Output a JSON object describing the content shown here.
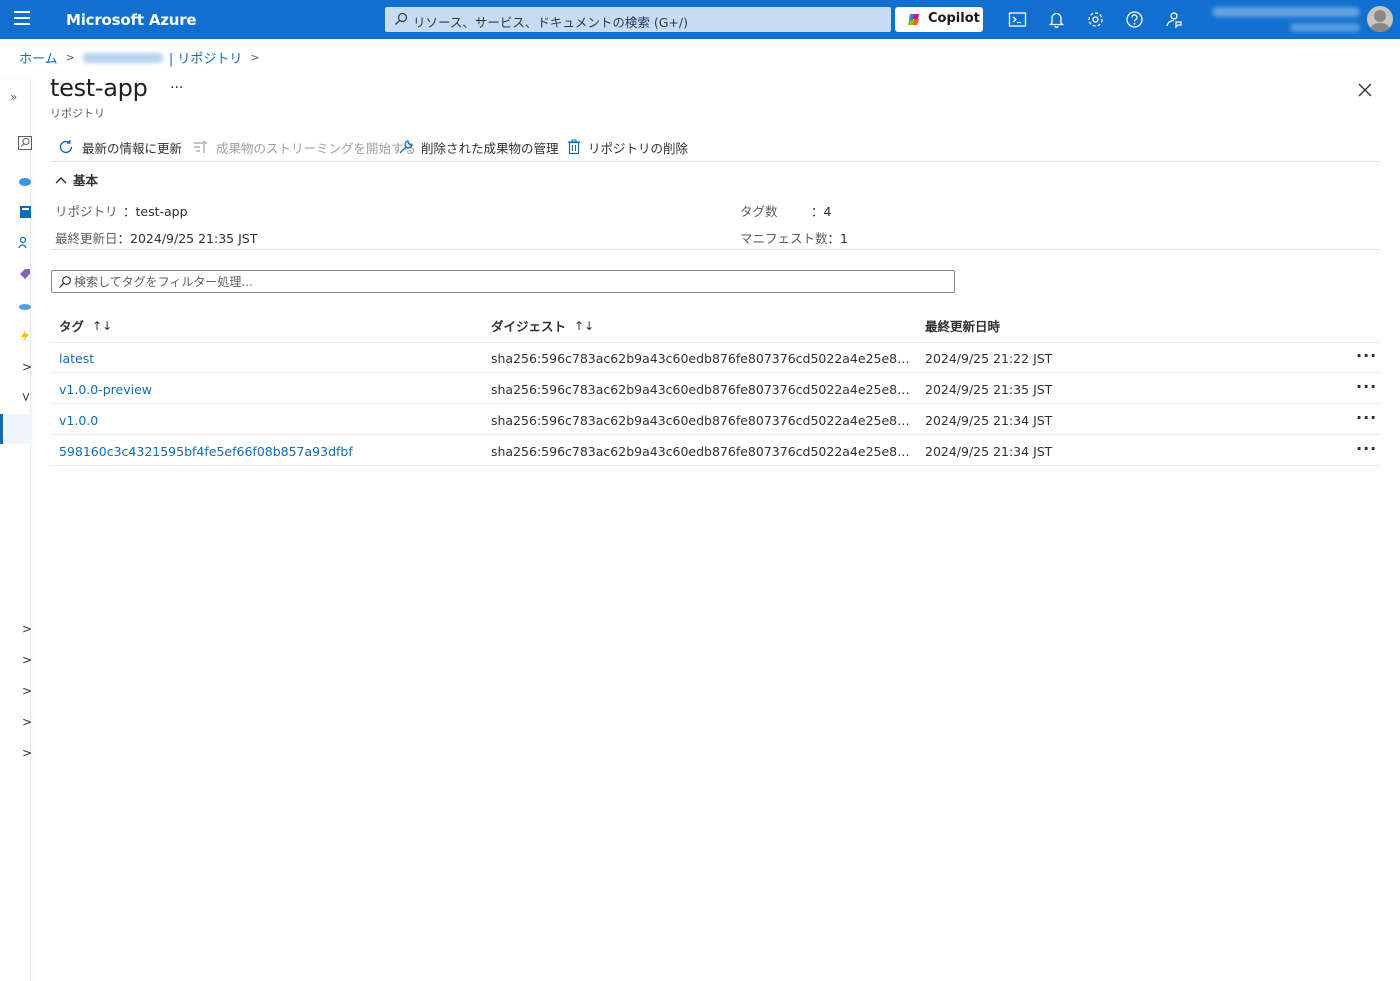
{
  "topbar": {
    "brand": "Microsoft Azure",
    "search_placeholder": "リソース、サービス、ドキュメントの検索 (G+/)",
    "copilot_label": "Copilot"
  },
  "breadcrumb": {
    "home": "ホーム",
    "registry": "| リポジトリ"
  },
  "blade": {
    "title": "test-app",
    "more": "···",
    "subtitle": "リポジトリ"
  },
  "commands": {
    "refresh": "最新の情報に更新",
    "stream": "成果物のストリーミングを開始する",
    "manage_deleted": "削除された成果物の管理",
    "delete_repo": "リポジトリの削除"
  },
  "essentials": {
    "header": "基本",
    "repo_label": "リポジトリ",
    "repo_value": "：test-app",
    "updated_label": "最終更新日",
    "updated_value": "：2024/9/25 21:35 JST",
    "tags_label": "タグ数",
    "tags_value": "：4",
    "manifests_label": "マニフェスト数",
    "manifests_value": "：1"
  },
  "filter": {
    "placeholder": "検索してタグをフィルター処理..."
  },
  "table": {
    "col_tag": "タグ",
    "col_digest": "ダイジェスト",
    "col_updated": "最終更新日時",
    "sort_glyph": "↑↓",
    "row_more": "···",
    "rows": [
      {
        "tag": "latest",
        "digest": "sha256:596c783ac62b9a43c60edb876fe807376cd5022a4e25e89…",
        "updated": "2024/9/25 21:22 JST"
      },
      {
        "tag": "v1.0.0-preview",
        "digest": "sha256:596c783ac62b9a43c60edb876fe807376cd5022a4e25e89…",
        "updated": "2024/9/25 21:35 JST"
      },
      {
        "tag": "v1.0.0",
        "digest": "sha256:596c783ac62b9a43c60edb876fe807376cd5022a4e25e89…",
        "updated": "2024/9/25 21:34 JST"
      },
      {
        "tag": "598160c3c4321595bf4fe5ef66f08b857a93dfbf",
        "digest": "sha256:596c783ac62b9a43c60edb876fe807376cd5022a4e25e89…",
        "updated": "2024/9/25 21:34 JST"
      }
    ]
  }
}
